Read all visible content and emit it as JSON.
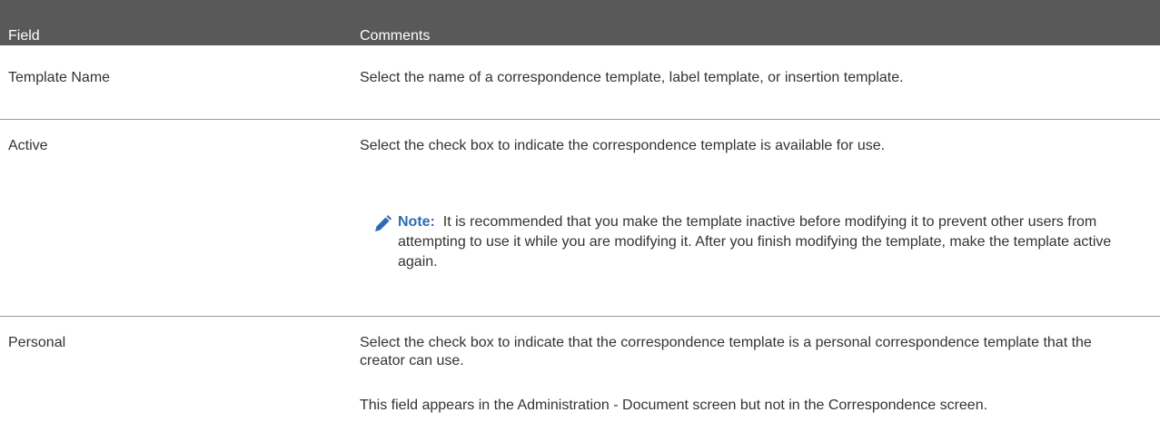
{
  "header": {
    "field": "Field",
    "comments": "Comments"
  },
  "rows": [
    {
      "field": "Template Name",
      "comments": [
        "Select the name of a correspondence template, label template, or insertion template."
      ]
    },
    {
      "field": "Active",
      "comments": [
        "Select the check box to indicate the correspondence template is available for use."
      ],
      "note": {
        "icon": "pencil-icon",
        "label": "Note:",
        "text": "It is recommended that you make the template inactive before modifying it to prevent other users from attempting to use it while you are modifying it. After you finish modifying the template, make the template active again."
      }
    },
    {
      "field": "Personal",
      "comments": [
        "Select the check box to indicate that the correspondence template is a personal correspondence template that the creator can use.",
        "This field appears in the Administration - Document screen but not in the Correspondence screen."
      ]
    }
  ],
  "colors": {
    "header_bg": "#595959",
    "header_text": "#ffffff",
    "body_text": "#333333",
    "note_label": "#2f6bb3",
    "note_icon": "#2f6bb3",
    "divider": "#9a9a9a"
  }
}
